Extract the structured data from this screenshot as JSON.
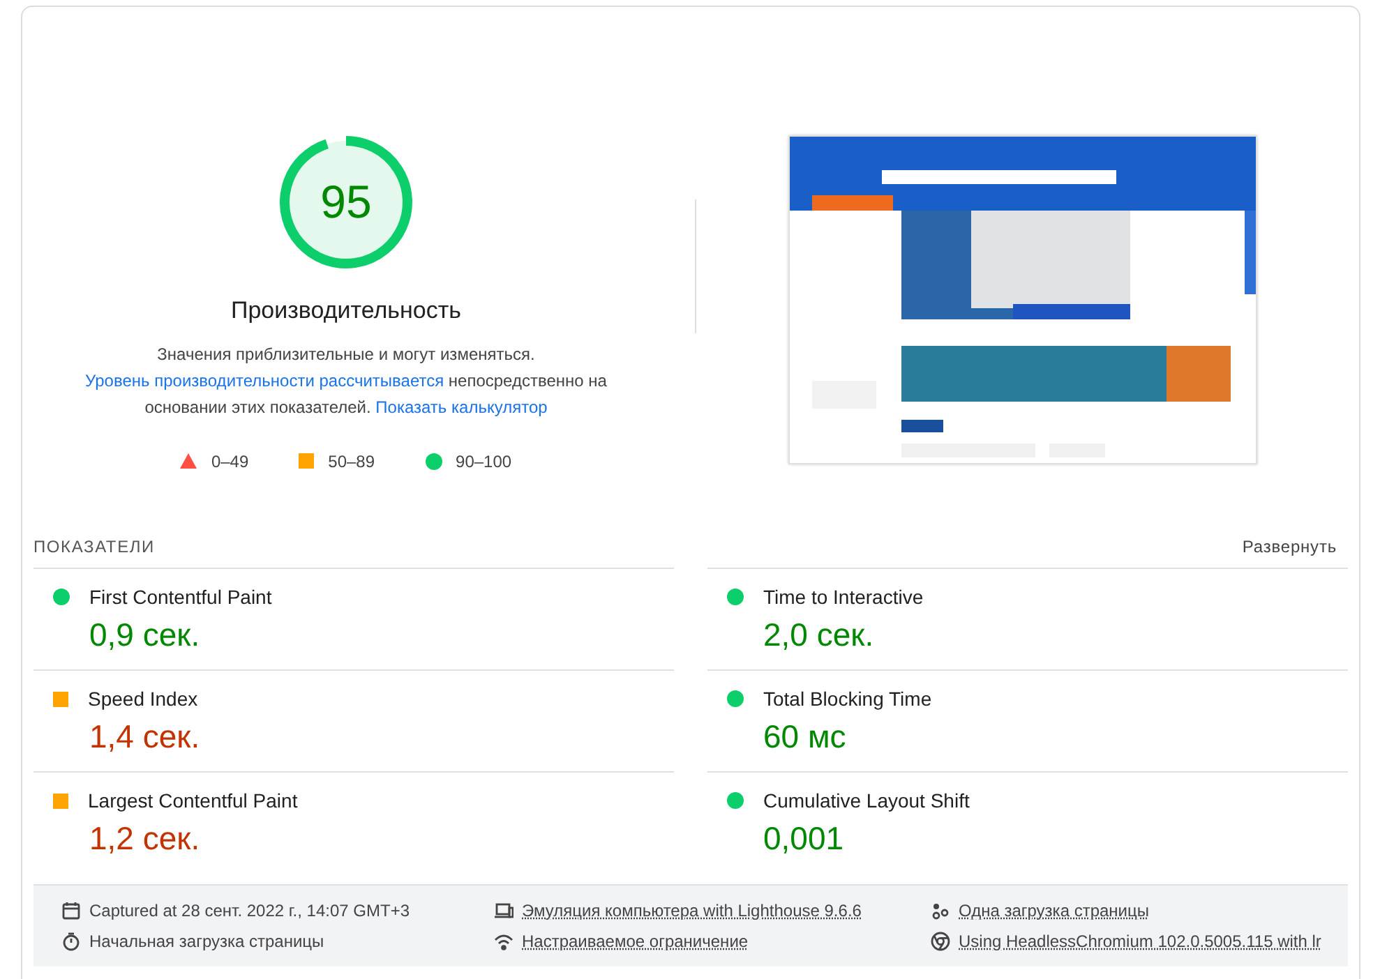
{
  "gauge": {
    "score": "95",
    "level": 0.95,
    "kind": "pass",
    "title": "Производительность"
  },
  "description": [
    {
      "text": "Значения приблизительные и могут изменяться. ",
      "link": false
    },
    {
      "text": "Уровень ",
      "link": true
    },
    {
      "text": "производительности рассчитывается",
      "link": true
    },
    {
      "text": " непосредственно на основании этих показателей. ",
      "link": false
    },
    {
      "text": "Показать калькулятор",
      "link": true
    }
  ],
  "legend": [
    {
      "kind": "fail",
      "label": "0–49"
    },
    {
      "kind": "average",
      "label": "50–89"
    },
    {
      "kind": "pass",
      "label": "90–100"
    }
  ],
  "metrics": {
    "heading": "ПОКАЗАТЕЛИ",
    "toggle": "Развернуть",
    "items": [
      {
        "name": "First Contentful Paint",
        "value": "0,9 сек.",
        "kind": "pass"
      },
      {
        "name": "Time to Interactive",
        "value": "2,0 сек.",
        "kind": "pass"
      },
      {
        "name": "Speed Index",
        "value": "1,4 сек.",
        "kind": "average"
      },
      {
        "name": "Total Blocking Time",
        "value": "60 мс",
        "kind": "pass"
      },
      {
        "name": "Largest Contentful Paint",
        "value": "1,2 сек.",
        "kind": "average"
      },
      {
        "name": "Cumulative Layout Shift",
        "value": "0,001",
        "kind": "pass"
      }
    ]
  },
  "footer": [
    {
      "text": "Captured at 28 сент. 2022 г., 14:07 GMT+3",
      "link": false
    },
    {
      "text": "Эмуляция компьютера with Lighthouse 9.6.6",
      "link": true
    },
    {
      "text": "Одна загрузка страницы",
      "link": true
    },
    {
      "text": "Начальная загрузка страницы",
      "link": false
    },
    {
      "text": "Настраиваемое ограничение",
      "link": true
    },
    {
      "text": "Using HeadlessChromium 102.0.5005.115 with lr",
      "link": true
    }
  ]
}
